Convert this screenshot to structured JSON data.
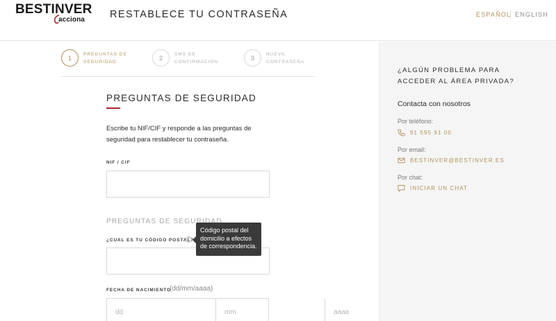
{
  "header": {
    "logo_word": "BESTINVER",
    "logo_sub": "acciona",
    "title": "RESTABLECE TU CONTRASEÑA",
    "lang_es": "ESPAÑOL",
    "lang_en": "ENGLISH"
  },
  "steps": [
    {
      "number": "1",
      "label": "PREGUNTAS DE SEGURIDAD",
      "active": true
    },
    {
      "number": "2",
      "label": "SMS DE CONFIRMACIÓN",
      "active": false
    },
    {
      "number": "3",
      "label": "NUEVA CONTRASEÑA",
      "active": false
    }
  ],
  "form": {
    "title": "PREGUNTAS DE SEGURIDAD",
    "description": "Escribe tu NIF/CIF y responde a las preguntas de seguridad para restablecer tu contraseña.",
    "nif_label": "NIF / CIF",
    "nif_value": "",
    "section_sub": "PREGUNTAS DE SEGURIDAD",
    "postal_label": "¿CUAL ES TU CÓDIGO POSTAL?",
    "help_glyph": "?",
    "postal_value": "",
    "tooltip": "Código postal del domicilio a efectos de correspondencia.",
    "birth_label": "FECHA DE NACIMIENTO",
    "birth_hint": "(dd/mm/aaaa)",
    "dd_placeholder": "dd",
    "mm_placeholder": "mm",
    "aaaa_placeholder": "aaaa"
  },
  "side": {
    "title": "¿ALGÚN PROBLEMA PARA ACCEDER AL ÁREA PRIVADA?",
    "contact": "Contacta con nosotros",
    "phone_label": "Por teléfono:",
    "phone": "91 595 91 00",
    "email_label": "Por email:",
    "email": "BESTINVER@BESTINVER.ES",
    "chat_label": "Por chat:",
    "chat": "INICIAR UN CHAT"
  },
  "colors": {
    "accent_gold": "#b3905a",
    "accent_red": "#a8232a",
    "panel_bg": "#f5f5f5"
  },
  "icons": [
    "phone-icon",
    "mail-icon",
    "chat-icon",
    "help-icon",
    "acciona-mark-icon"
  ]
}
